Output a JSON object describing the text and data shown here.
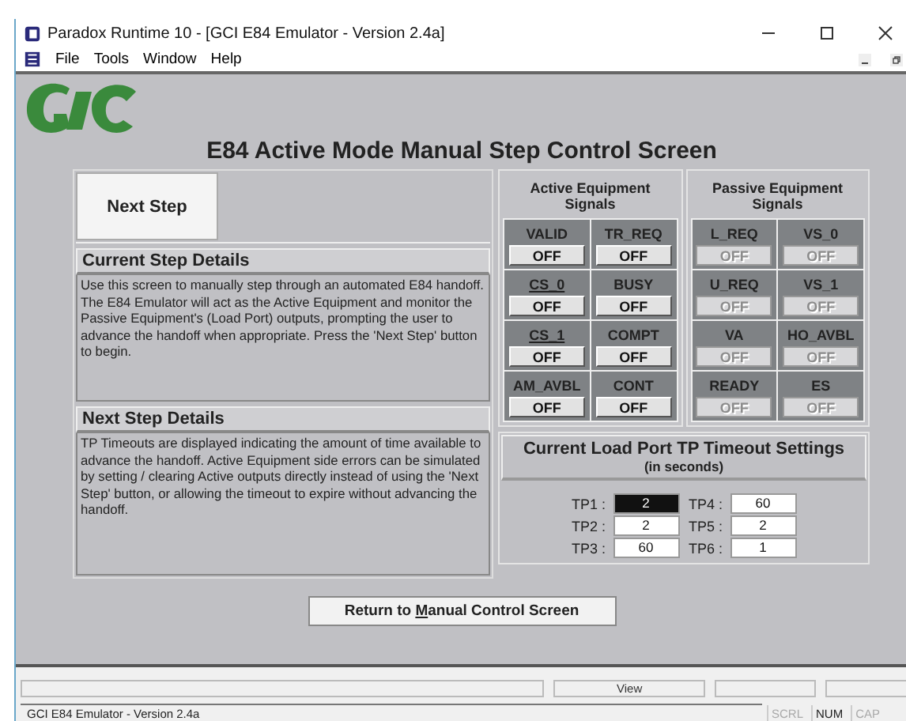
{
  "window": {
    "title": "Paradox Runtime 10 - [GCI E84 Emulator - Version 2.4a]"
  },
  "menu": [
    "File",
    "Tools",
    "Window",
    "Help"
  ],
  "heading": "E84 Active Mode Manual Step Control Screen",
  "next_step_button": "Next Step",
  "current_step": {
    "title": "Current Step Details",
    "text": "Use this screen to manually step through an automated E84 handoff.  The E84 Emulator will act as the Active Equipment and monitor the Passive Equipment's (Load Port) outputs, prompting the user to advance the handoff when appropriate.   Press the 'Next Step' button to begin."
  },
  "next_step": {
    "title": "Next Step Details",
    "text": "TP Timeouts are displayed indicating the amount of time available to advance the handoff.  Active Equipment side errors can be simulated by setting / clearing Active outputs directly instead of using the 'Next Step' button, or allowing the timeout to expire without advancing the handoff."
  },
  "signal_groups": [
    {
      "title": "Active Equipment",
      "subtitle": "Signals",
      "signals": [
        {
          "name": "VALID",
          "value": "OFF",
          "underlined": false,
          "disabled": false
        },
        {
          "name": "TR_REQ",
          "value": "OFF",
          "underlined": false,
          "disabled": false
        },
        {
          "name": "CS_0",
          "value": "OFF",
          "underlined": true,
          "disabled": false
        },
        {
          "name": "BUSY",
          "value": "OFF",
          "underlined": false,
          "disabled": false
        },
        {
          "name": "CS_1",
          "value": "OFF",
          "underlined": true,
          "disabled": false
        },
        {
          "name": "COMPT",
          "value": "OFF",
          "underlined": false,
          "disabled": false
        },
        {
          "name": "AM_AVBL",
          "value": "OFF",
          "underlined": false,
          "disabled": false
        },
        {
          "name": "CONT",
          "value": "OFF",
          "underlined": false,
          "disabled": false
        }
      ]
    },
    {
      "title": "Passive Equipment",
      "subtitle": "Signals",
      "signals": [
        {
          "name": "L_REQ",
          "value": "OFF",
          "underlined": false,
          "disabled": true
        },
        {
          "name": "VS_0",
          "value": "OFF",
          "underlined": false,
          "disabled": true
        },
        {
          "name": "U_REQ",
          "value": "OFF",
          "underlined": false,
          "disabled": true
        },
        {
          "name": "VS_1",
          "value": "OFF",
          "underlined": false,
          "disabled": true
        },
        {
          "name": "VA",
          "value": "OFF",
          "underlined": false,
          "disabled": true
        },
        {
          "name": "HO_AVBL",
          "value": "OFF",
          "underlined": false,
          "disabled": true
        },
        {
          "name": "READY",
          "value": "OFF",
          "underlined": false,
          "disabled": true
        },
        {
          "name": "ES",
          "value": "OFF",
          "underlined": false,
          "disabled": true
        }
      ]
    }
  ],
  "timeouts": {
    "title": "Current Load Port TP Timeout Settings",
    "subtitle": "(in seconds)",
    "fields": [
      {
        "label": "TP1 :",
        "value": "2",
        "selected": true
      },
      {
        "label": "TP4 :",
        "value": "60",
        "selected": false
      },
      {
        "label": "TP2 :",
        "value": "2",
        "selected": false
      },
      {
        "label": "TP5 :",
        "value": "2",
        "selected": false
      },
      {
        "label": "TP3 :",
        "value": "60",
        "selected": false
      },
      {
        "label": "TP6 :",
        "value": "1",
        "selected": false
      }
    ]
  },
  "return_button": {
    "before": "Return to ",
    "access_key": "M",
    "after": "anual Control Screen"
  },
  "status_view_pane": "View",
  "status_bar": {
    "text": "GCI E84 Emulator - Version 2.4a",
    "indicators": [
      {
        "label": "SCRL",
        "disabled": true
      },
      {
        "label": "NUM",
        "disabled": false
      },
      {
        "label": "CAP",
        "disabled": true
      }
    ]
  }
}
